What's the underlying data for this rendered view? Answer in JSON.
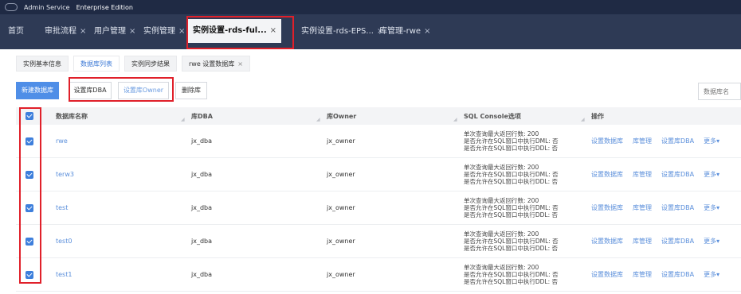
{
  "app": {
    "name": "Admin Service",
    "edition": "Enterprise Edition"
  },
  "tabs": [
    {
      "label": "首页",
      "closable": false
    },
    {
      "label": "审批流程",
      "closable": true
    },
    {
      "label": "用户管理",
      "closable": true
    },
    {
      "label": "实例管理",
      "closable": true
    },
    {
      "label": "实例设置-rds-ful...",
      "closable": true,
      "active": true
    },
    {
      "label": "实例设置-rds-EPS...",
      "closable": true
    },
    {
      "label": "库管理-rwe",
      "closable": true
    }
  ],
  "close_glyph": "×",
  "subtabs": [
    {
      "label": "实例基本信息"
    },
    {
      "label": "数据库列表",
      "active": true
    },
    {
      "label": "实例同步结果"
    },
    {
      "label": "rwe 设置数据库",
      "closable": true
    }
  ],
  "toolbar": {
    "new_db": "新建数据库",
    "set_dba": "设置库DBA",
    "set_owner": "设置库Owner",
    "delete_db": "删除库",
    "search_placeholder": "数据库名"
  },
  "table": {
    "headers": {
      "name": "数据库名称",
      "dba": "库DBA",
      "owner": "库Owner",
      "console": "SQL Console选项",
      "ops": "操作"
    },
    "rows": [
      {
        "name": "rwe",
        "dba": "jx_dba",
        "owner": "jx_owner",
        "console": [
          "单次查询最大返回行数: 200",
          "是否允许在SQL窗口中执行DML: 否",
          "是否允许在SQL窗口中执行DDL: 否"
        ]
      },
      {
        "name": "terw3",
        "dba": "jx_dba",
        "owner": "jx_owner",
        "console": [
          "单次查询最大返回行数: 200",
          "是否允许在SQL窗口中执行DML: 否",
          "是否允许在SQL窗口中执行DDL: 否"
        ]
      },
      {
        "name": "test",
        "dba": "jx_dba",
        "owner": "jx_owner",
        "console": [
          "单次查询最大返回行数: 200",
          "是否允许在SQL窗口中执行DML: 否",
          "是否允许在SQL窗口中执行DDL: 否"
        ]
      },
      {
        "name": "test0",
        "dba": "jx_dba",
        "owner": "jx_owner",
        "console": [
          "单次查询最大返回行数: 200",
          "是否允许在SQL窗口中执行DML: 否",
          "是否允许在SQL窗口中执行DDL: 否"
        ]
      },
      {
        "name": "test1",
        "dba": "jx_dba",
        "owner": "jx_owner",
        "console": [
          "单次查询最大返回行数: 200",
          "是否允许在SQL窗口中执行DML: 否",
          "是否允许在SQL窗口中执行DDL: 否"
        ]
      }
    ],
    "ops": [
      "设置数据库",
      "库管理",
      "设置库DBA",
      "更多▾"
    ]
  }
}
